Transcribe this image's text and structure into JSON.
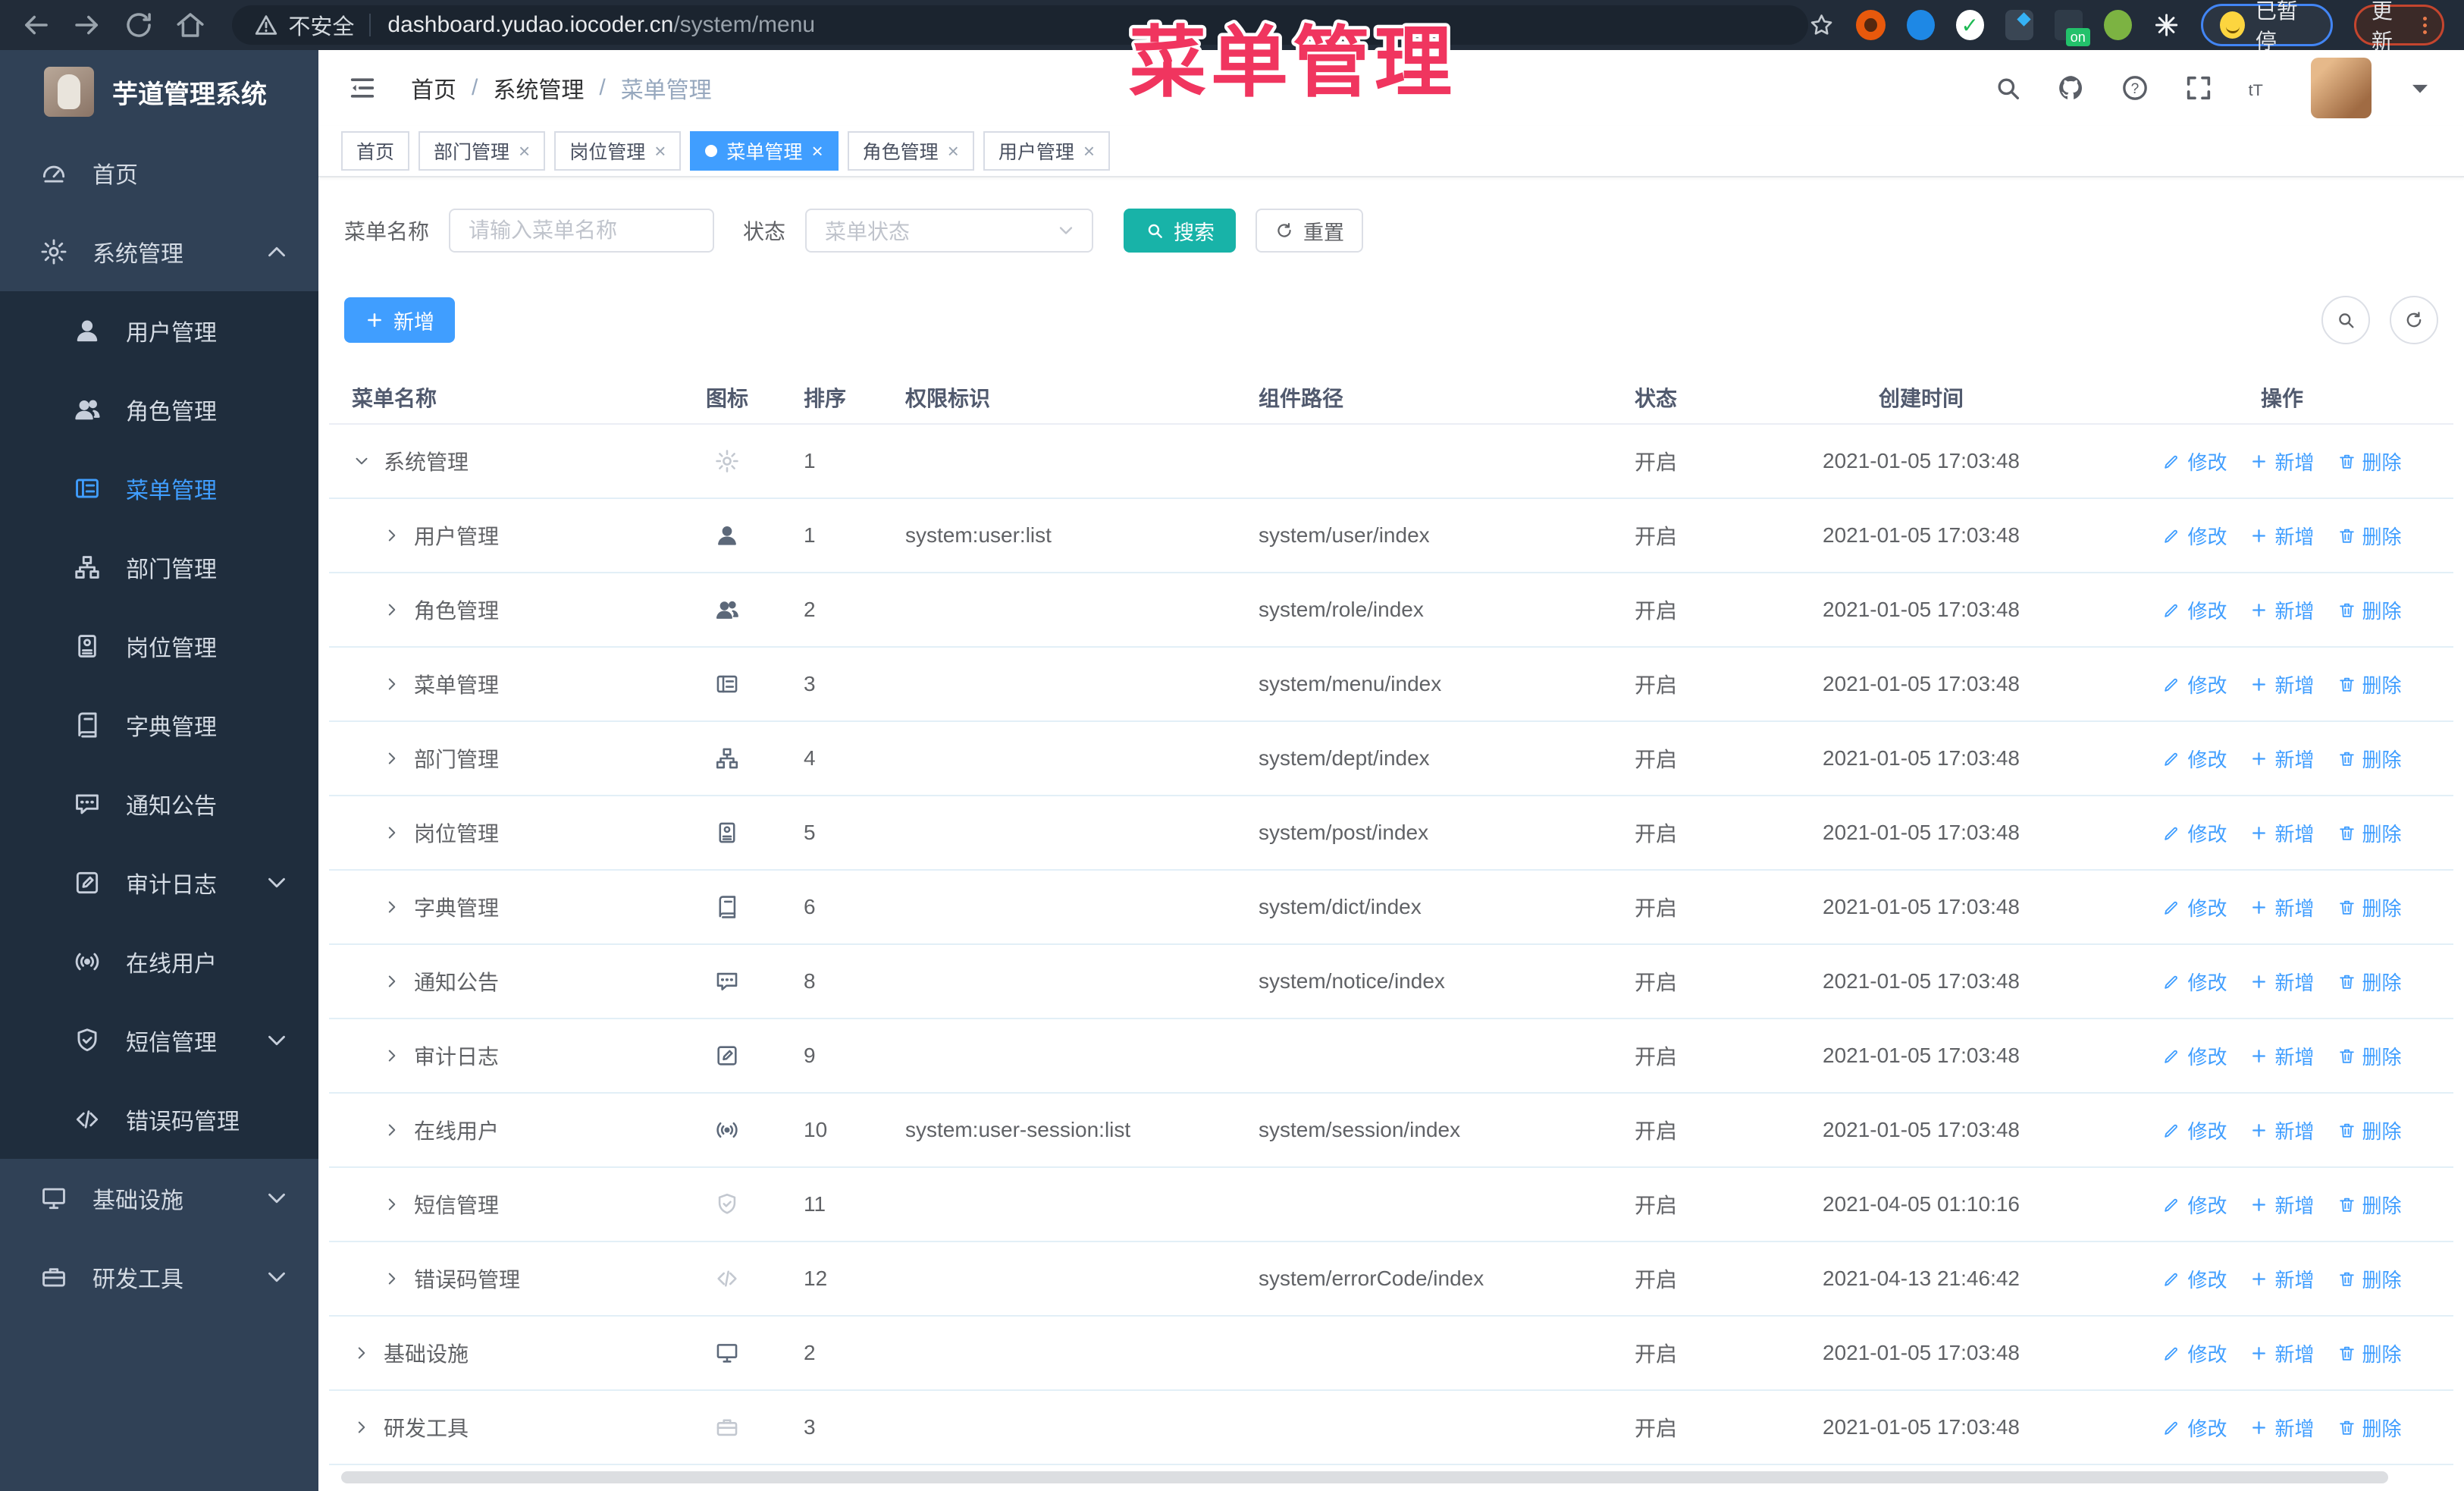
{
  "annotation": {
    "title": "菜单管理"
  },
  "colors": {
    "accent": "#409eff",
    "search_button": "#18b3a8",
    "sidebar_bg": "#304156",
    "submenu_bg": "#1f2d3d",
    "annotation": "#f0355f",
    "link": "#409eff"
  },
  "browser": {
    "security_label": "不安全",
    "url_host": "dashboard.yudao.iocoder.cn",
    "url_path": "/system/menu",
    "on_badge": "on",
    "paused_label": "已暂停",
    "update_label": "更新"
  },
  "sidebar": {
    "logo_title": "芋道管理系统",
    "items": [
      {
        "slug": "home",
        "label": "首页",
        "icon": "dashboard",
        "level": 0
      },
      {
        "slug": "system-management",
        "label": "系统管理",
        "icon": "gear",
        "level": 0,
        "chevron": "up"
      },
      {
        "slug": "user-management",
        "label": "用户管理",
        "icon": "user",
        "level": 1
      },
      {
        "slug": "role-management",
        "label": "角色管理",
        "icon": "users",
        "level": 1
      },
      {
        "slug": "menu-management",
        "label": "菜单管理",
        "icon": "menu-tree",
        "level": 1,
        "active": true
      },
      {
        "slug": "dept-management",
        "label": "部门管理",
        "icon": "org-tree",
        "level": 1
      },
      {
        "slug": "post-management",
        "label": "岗位管理",
        "icon": "badge",
        "level": 1
      },
      {
        "slug": "dict-management",
        "label": "字典管理",
        "icon": "book",
        "level": 1
      },
      {
        "slug": "notice",
        "label": "通知公告",
        "icon": "message",
        "level": 1
      },
      {
        "slug": "audit-log",
        "label": "审计日志",
        "icon": "edit-log",
        "level": 1,
        "chevron": "down"
      },
      {
        "slug": "online-users",
        "label": "在线用户",
        "icon": "online",
        "level": 1
      },
      {
        "slug": "sms-management",
        "label": "短信管理",
        "icon": "shield",
        "level": 1,
        "chevron": "down"
      },
      {
        "slug": "error-code-management",
        "label": "错误码管理",
        "icon": "code",
        "level": 1
      },
      {
        "slug": "infrastructure",
        "label": "基础设施",
        "icon": "monitor",
        "level": 0,
        "chevron": "down"
      },
      {
        "slug": "dev-tools",
        "label": "研发工具",
        "icon": "briefcase",
        "level": 0,
        "chevron": "down"
      }
    ]
  },
  "navbar": {
    "breadcrumb": [
      "首页",
      "系统管理",
      "菜单管理"
    ]
  },
  "tabs": [
    {
      "slug": "home",
      "label": "首页",
      "closable": false,
      "active": false
    },
    {
      "slug": "dept-management",
      "label": "部门管理",
      "closable": true,
      "active": false
    },
    {
      "slug": "post-management",
      "label": "岗位管理",
      "closable": true,
      "active": false
    },
    {
      "slug": "menu-management",
      "label": "菜单管理",
      "closable": true,
      "active": true
    },
    {
      "slug": "role-management",
      "label": "角色管理",
      "closable": true,
      "active": false
    },
    {
      "slug": "user-management",
      "label": "用户管理",
      "closable": true,
      "active": false
    }
  ],
  "filters": {
    "name_label": "菜单名称",
    "name_placeholder": "请输入菜单名称",
    "status_label": "状态",
    "status_placeholder": "菜单状态",
    "search_label": "搜索",
    "reset_label": "重置"
  },
  "toolbar": {
    "add_label": "新增"
  },
  "table": {
    "headers": [
      "菜单名称",
      "图标",
      "排序",
      "权限标识",
      "组件路径",
      "状态",
      "创建时间",
      "操作"
    ],
    "action_labels": {
      "edit": "修改",
      "add": "新增",
      "delete": "删除"
    },
    "rows": [
      {
        "name": "系统管理",
        "level": 0,
        "arrow": "down",
        "icon": "gear",
        "icon_light": true,
        "sort": "1",
        "permission": "",
        "component": "",
        "status": "开启",
        "created": "2021-01-05 17:03:48"
      },
      {
        "name": "用户管理",
        "level": 1,
        "arrow": "right",
        "icon": "user",
        "icon_light": false,
        "sort": "1",
        "permission": "system:user:list",
        "component": "system/user/index",
        "status": "开启",
        "created": "2021-01-05 17:03:48"
      },
      {
        "name": "角色管理",
        "level": 1,
        "arrow": "right",
        "icon": "users",
        "icon_light": false,
        "sort": "2",
        "permission": "",
        "component": "system/role/index",
        "status": "开启",
        "created": "2021-01-05 17:03:48"
      },
      {
        "name": "菜单管理",
        "level": 1,
        "arrow": "right",
        "icon": "menu-tree",
        "icon_light": false,
        "sort": "3",
        "permission": "",
        "component": "system/menu/index",
        "status": "开启",
        "created": "2021-01-05 17:03:48"
      },
      {
        "name": "部门管理",
        "level": 1,
        "arrow": "right",
        "icon": "org-tree",
        "icon_light": false,
        "sort": "4",
        "permission": "",
        "component": "system/dept/index",
        "status": "开启",
        "created": "2021-01-05 17:03:48"
      },
      {
        "name": "岗位管理",
        "level": 1,
        "arrow": "right",
        "icon": "badge",
        "icon_light": false,
        "sort": "5",
        "permission": "",
        "component": "system/post/index",
        "status": "开启",
        "created": "2021-01-05 17:03:48"
      },
      {
        "name": "字典管理",
        "level": 1,
        "arrow": "right",
        "icon": "book",
        "icon_light": false,
        "sort": "6",
        "permission": "",
        "component": "system/dict/index",
        "status": "开启",
        "created": "2021-01-05 17:03:48"
      },
      {
        "name": "通知公告",
        "level": 1,
        "arrow": "right",
        "icon": "message",
        "icon_light": false,
        "sort": "8",
        "permission": "",
        "component": "system/notice/index",
        "status": "开启",
        "created": "2021-01-05 17:03:48"
      },
      {
        "name": "审计日志",
        "level": 1,
        "arrow": "right",
        "icon": "edit-log",
        "icon_light": false,
        "sort": "9",
        "permission": "",
        "component": "",
        "status": "开启",
        "created": "2021-01-05 17:03:48"
      },
      {
        "name": "在线用户",
        "level": 1,
        "arrow": "right",
        "icon": "online",
        "icon_light": false,
        "sort": "10",
        "permission": "system:user-session:list",
        "component": "system/session/index",
        "status": "开启",
        "created": "2021-01-05 17:03:48"
      },
      {
        "name": "短信管理",
        "level": 1,
        "arrow": "right",
        "icon": "shield",
        "icon_light": true,
        "sort": "11",
        "permission": "",
        "component": "",
        "status": "开启",
        "created": "2021-04-05 01:10:16"
      },
      {
        "name": "错误码管理",
        "level": 1,
        "arrow": "right",
        "icon": "code",
        "icon_light": true,
        "sort": "12",
        "permission": "",
        "component": "system/errorCode/index",
        "status": "开启",
        "created": "2021-04-13 21:46:42"
      },
      {
        "name": "基础设施",
        "level": 0,
        "arrow": "right",
        "icon": "monitor",
        "icon_light": false,
        "sort": "2",
        "permission": "",
        "component": "",
        "status": "开启",
        "created": "2021-01-05 17:03:48"
      },
      {
        "name": "研发工具",
        "level": 0,
        "arrow": "right",
        "icon": "briefcase",
        "icon_light": true,
        "sort": "3",
        "permission": "",
        "component": "",
        "status": "开启",
        "created": "2021-01-05 17:03:48"
      }
    ]
  }
}
